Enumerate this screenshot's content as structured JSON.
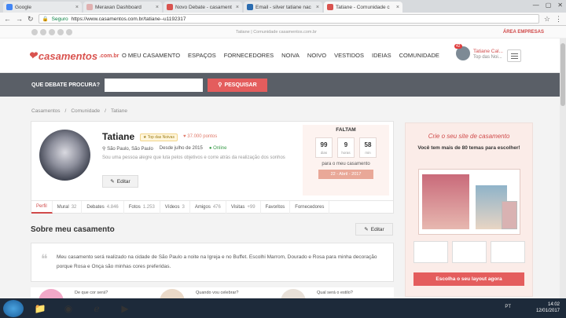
{
  "browser": {
    "tabs": [
      {
        "title": "Google",
        "color": "#4285f4"
      },
      {
        "title": "Meraxan Dashboard",
        "color": "#e0b0b0"
      },
      {
        "title": "Novo Debate - casament",
        "color": "#d9534f"
      },
      {
        "title": "Email - silver tatiane nac",
        "color": "#2b6cb0"
      },
      {
        "title": "Tatiane - Comunidade c",
        "color": "#d9534f"
      }
    ],
    "secure_label": "Seguro",
    "url": "https://www.casamentos.com.br/tatiane--u1192317"
  },
  "site": {
    "top_center": "Tatiane | Comunidade casamentos.com.br",
    "area_empresas": "ÁREA EMPRESAS",
    "logo": "casamentos",
    "logo_domain": ".com.br",
    "nav": [
      "O MEU CASAMENTO",
      "ESPAÇOS",
      "FORNECEDORES",
      "NOIVA",
      "NOIVO",
      "VESTIDOS",
      "IDEIAS",
      "COMUNIDADE"
    ],
    "user": {
      "name": "Tatiane Cal...",
      "sub": "Top das Noi...",
      "badge": "42"
    },
    "search": {
      "label": "QUE DEBATE PROCURA?",
      "button": "PESQUISAR"
    },
    "breadcrumbs": [
      "Casamentos",
      "/",
      "Comunidade",
      "/",
      "Tatiane"
    ]
  },
  "profile": {
    "name": "Tatiane",
    "badge": "Top das Noivas",
    "points": "37.000 pontos",
    "location": "São Paulo, São Paulo",
    "since": "Desde julho de 2015",
    "status": "Online",
    "bio": "Sou uma pessoa alegre que luta pelos objetivos e corre atrás da realização dos sonhos",
    "edit": "Editar",
    "faltam": {
      "title": "FALTAM",
      "days": "99",
      "days_l": "dias",
      "hours": "9",
      "hours_l": "horas",
      "mins": "58",
      "mins_l": "min",
      "note": "para o meu casamento",
      "date": "22 - Abril - 2017"
    },
    "tabs": [
      {
        "label": "Perfil",
        "n": ""
      },
      {
        "label": "Mural",
        "n": "32"
      },
      {
        "label": "Debates",
        "n": "4.846"
      },
      {
        "label": "Fotos",
        "n": "1.253"
      },
      {
        "label": "Vídeos",
        "n": "3"
      },
      {
        "label": "Amigos",
        "n": "476"
      },
      {
        "label": "Visitas",
        "n": "+99"
      },
      {
        "label": "Favoritos",
        "n": ""
      },
      {
        "label": "Fornecedores",
        "n": ""
      }
    ]
  },
  "about": {
    "title": "Sobre meu casamento",
    "edit": "Editar",
    "text": "Meu casamento será realizado na cidade de São Paulo a noite na Igreja e no Buffet. Escolhi Marrom, Dourado e Rosa para minha decoração porque Rosa e Onça são minhas cores preferidas.",
    "questions": [
      "De que cor será?",
      "Quando vou celebrar?",
      "Qual será o estilo?"
    ]
  },
  "ad": {
    "title": "Crie o seu site de casamento",
    "subtitle": "Você tem mais de 80 temas para escolher!",
    "button": "Escolha o seu layout agora"
  },
  "system": {
    "lang": "PT",
    "time": "14:02",
    "date": "12/01/2017"
  }
}
